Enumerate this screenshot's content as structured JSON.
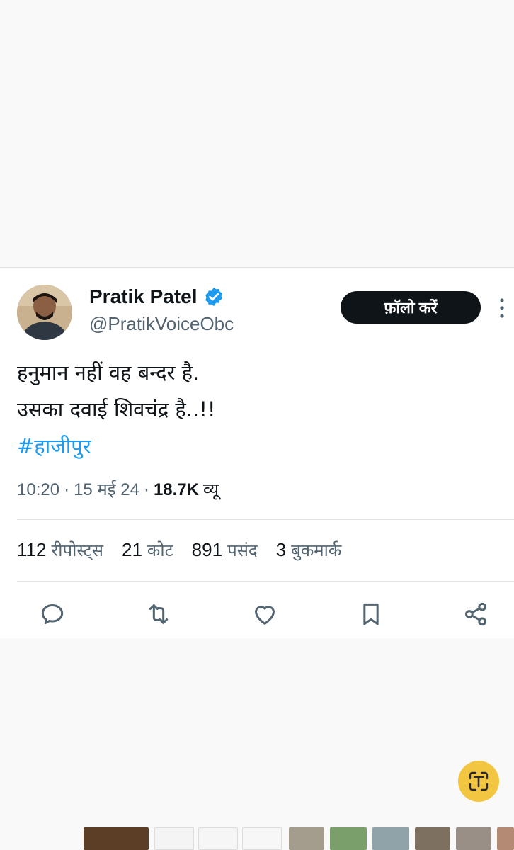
{
  "tweet": {
    "author": {
      "display_name": "Pratik Patel",
      "handle": "@PratikVoiceObc",
      "verified": true
    },
    "follow_label": "फ़ॉलो करें",
    "text_lines": [
      "हनुमान नहीं वह बन्दर है.",
      "उसका दवाई शिवचंद्र है..!!"
    ],
    "hashtag": "#हाजीपुर",
    "meta": {
      "time": "10:20",
      "date": "15 मई 24",
      "views_count": "18.7K",
      "views_label": "व्यू"
    },
    "stats": {
      "reposts_count": "112",
      "reposts_label": "रीपोस्ट्स",
      "quotes_count": "21",
      "quotes_label": "कोट",
      "likes_count": "891",
      "likes_label": "पसंद",
      "bookmarks_count": "3",
      "bookmarks_label": "बुकमार्क"
    },
    "actions": [
      "reply-icon",
      "repost-icon",
      "like-icon",
      "bookmark-icon",
      "share-icon"
    ]
  },
  "colors": {
    "text_primary": "#0f1419",
    "text_secondary": "#536471",
    "hashtag": "#1d9bf0",
    "verified": "#1d9bf0",
    "follow_button_bg": "#0f1419",
    "lens_button_bg": "#f3c642"
  }
}
